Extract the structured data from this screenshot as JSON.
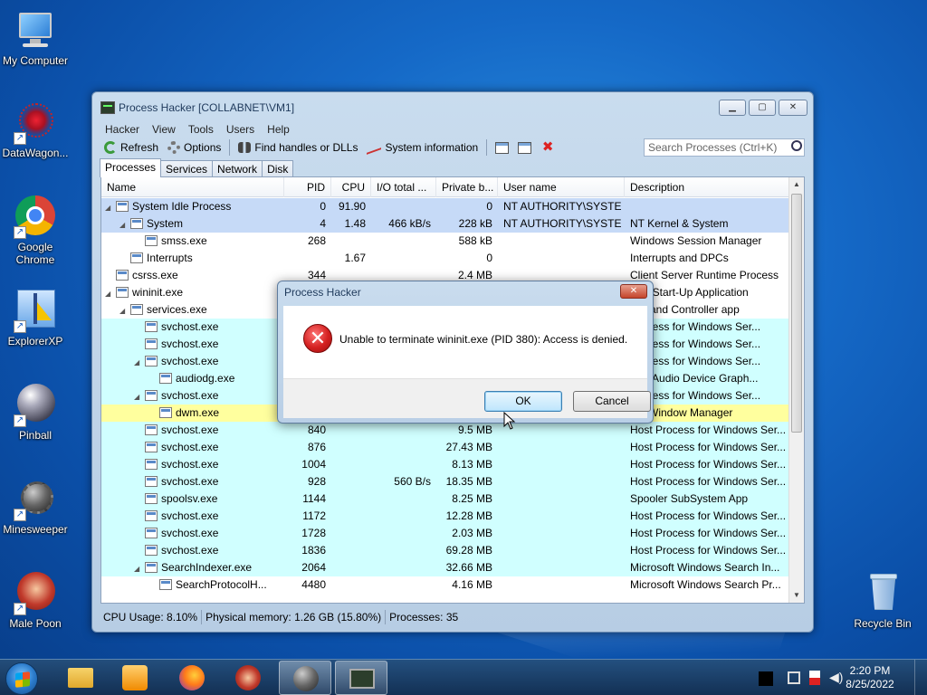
{
  "desktop": {
    "icons": [
      {
        "label": "My Computer"
      },
      {
        "label": "DataWagon..."
      },
      {
        "label": "Google Chrome"
      },
      {
        "label": "ExplorerXP"
      },
      {
        "label": "Pinball"
      },
      {
        "label": "Minesweeper"
      },
      {
        "label": "Male Poon"
      },
      {
        "label": "Recycle Bin"
      }
    ]
  },
  "window": {
    "title": "Process Hacker [COLLABNET\\VM1]",
    "menu": [
      "Hacker",
      "View",
      "Tools",
      "Users",
      "Help"
    ],
    "toolbar": {
      "refresh": "Refresh",
      "options": "Options",
      "find_handles": "Find handles or DLLs",
      "system_info": "System information",
      "search_placeholder": "Search Processes (Ctrl+K)"
    },
    "tabs": [
      "Processes",
      "Services",
      "Network",
      "Disk"
    ],
    "columns": [
      "Name",
      "PID",
      "CPU",
      "I/O total ...",
      "Private b...",
      "User name",
      "Description"
    ],
    "rows": [
      {
        "name": "System Idle Process",
        "pid": "0",
        "cpu": "91.90",
        "io": "",
        "priv": "0",
        "user": "NT AUTHORITY\\SYSTEM",
        "desc": ""
      },
      {
        "name": "System",
        "pid": "4",
        "cpu": "1.48",
        "io": "466 kB/s",
        "priv": "228 kB",
        "user": "NT AUTHORITY\\SYSTEM",
        "desc": "NT Kernel & System"
      },
      {
        "name": "smss.exe",
        "pid": "268",
        "cpu": "",
        "io": "",
        "priv": "588 kB",
        "user": "",
        "desc": "Windows Session Manager"
      },
      {
        "name": "Interrupts",
        "pid": "",
        "cpu": "1.67",
        "io": "",
        "priv": "0",
        "user": "",
        "desc": "Interrupts and DPCs"
      },
      {
        "name": "csrss.exe",
        "pid": "344",
        "cpu": "",
        "io": "",
        "priv": "2.4 MB",
        "user": "",
        "desc": "Client Server Runtime Process"
      },
      {
        "name": "wininit.exe",
        "pid": "",
        "cpu": "",
        "io": "",
        "priv": "",
        "user": "",
        "desc": "ows Start-Up Application"
      },
      {
        "name": "services.exe",
        "pid": "",
        "cpu": "",
        "io": "",
        "priv": "",
        "user": "",
        "desc": "ces and Controller app"
      },
      {
        "name": "svchost.exe",
        "pid": "",
        "cpu": "",
        "io": "",
        "priv": "",
        "user": "",
        "desc": "Process for Windows Ser..."
      },
      {
        "name": "svchost.exe",
        "pid": "",
        "cpu": "",
        "io": "",
        "priv": "",
        "user": "",
        "desc": "Process for Windows Ser..."
      },
      {
        "name": "svchost.exe",
        "pid": "",
        "cpu": "",
        "io": "",
        "priv": "",
        "user": "",
        "desc": "Process for Windows Ser..."
      },
      {
        "name": "audiodg.exe",
        "pid": "",
        "cpu": "",
        "io": "",
        "priv": "",
        "user": "",
        "desc": "ows Audio Device Graph..."
      },
      {
        "name": "svchost.exe",
        "pid": "",
        "cpu": "",
        "io": "",
        "priv": "",
        "user": "",
        "desc": "Process for Windows Ser..."
      },
      {
        "name": "dwm.exe",
        "pid": "",
        "cpu": "",
        "io": "",
        "priv": "",
        "user": "",
        "desc": "top Window Manager"
      },
      {
        "name": "svchost.exe",
        "pid": "840",
        "cpu": "",
        "io": "",
        "priv": "9.5 MB",
        "user": "",
        "desc": "Host Process for Windows Ser..."
      },
      {
        "name": "svchost.exe",
        "pid": "876",
        "cpu": "",
        "io": "",
        "priv": "27.43 MB",
        "user": "",
        "desc": "Host Process for Windows Ser..."
      },
      {
        "name": "svchost.exe",
        "pid": "1004",
        "cpu": "",
        "io": "",
        "priv": "8.13 MB",
        "user": "",
        "desc": "Host Process for Windows Ser..."
      },
      {
        "name": "svchost.exe",
        "pid": "928",
        "cpu": "",
        "io": "560 B/s",
        "priv": "18.35 MB",
        "user": "",
        "desc": "Host Process for Windows Ser..."
      },
      {
        "name": "spoolsv.exe",
        "pid": "1144",
        "cpu": "",
        "io": "",
        "priv": "8.25 MB",
        "user": "",
        "desc": "Spooler SubSystem App"
      },
      {
        "name": "svchost.exe",
        "pid": "1172",
        "cpu": "",
        "io": "",
        "priv": "12.28 MB",
        "user": "",
        "desc": "Host Process for Windows Ser..."
      },
      {
        "name": "svchost.exe",
        "pid": "1728",
        "cpu": "",
        "io": "",
        "priv": "2.03 MB",
        "user": "",
        "desc": "Host Process for Windows Ser..."
      },
      {
        "name": "svchost.exe",
        "pid": "1836",
        "cpu": "",
        "io": "",
        "priv": "69.28 MB",
        "user": "",
        "desc": "Host Process for Windows Ser..."
      },
      {
        "name": "SearchIndexer.exe",
        "pid": "2064",
        "cpu": "",
        "io": "",
        "priv": "32.66 MB",
        "user": "",
        "desc": "Microsoft Windows Search In..."
      },
      {
        "name": "SearchProtocolH...",
        "pid": "4480",
        "cpu": "",
        "io": "",
        "priv": "4.16 MB",
        "user": "",
        "desc": "Microsoft Windows Search Pr..."
      }
    ],
    "status": {
      "cpu": "CPU Usage: 8.10%",
      "memory": "Physical memory: 1.26 GB (15.80%)",
      "processes": "Processes: 35"
    }
  },
  "dialog": {
    "title": "Process Hacker",
    "message": "Unable to terminate wininit.exe (PID 380): Access is denied.",
    "ok": "OK",
    "cancel": "Cancel"
  },
  "taskbar": {
    "time": "2:20 PM",
    "date": "8/25/2022"
  },
  "colors": {
    "system_row": "#c6daf7",
    "service_row": "#d0ffff",
    "highlight_row": "#ffff9e"
  }
}
